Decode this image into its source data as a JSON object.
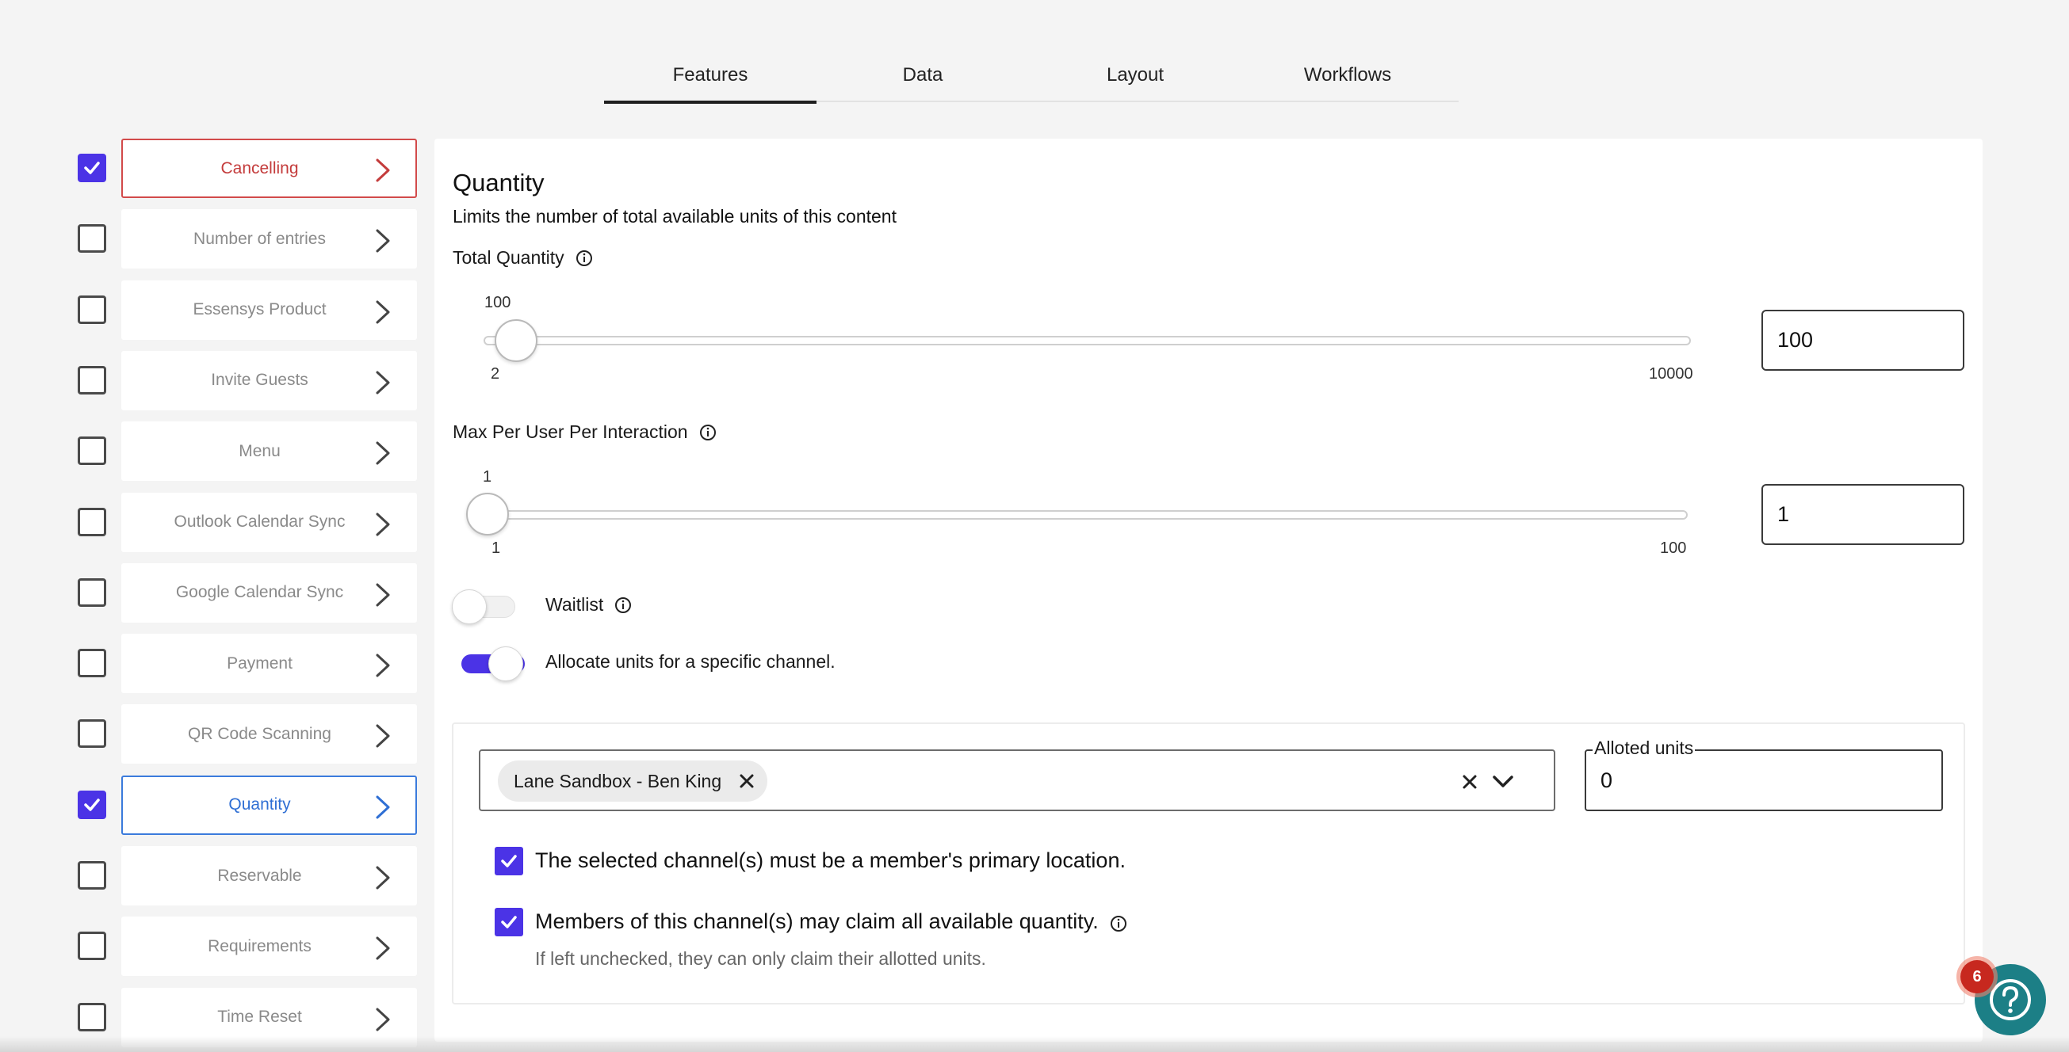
{
  "tabs": [
    {
      "label": "Features",
      "active": true
    },
    {
      "label": "Data",
      "active": false
    },
    {
      "label": "Layout",
      "active": false
    },
    {
      "label": "Workflows",
      "active": false
    }
  ],
  "sidebar": {
    "items": [
      {
        "label": "Cancelling",
        "checked": true,
        "state": "active-red"
      },
      {
        "label": "Number of entries",
        "checked": false
      },
      {
        "label": "Essensys Product",
        "checked": false
      },
      {
        "label": "Invite Guests",
        "checked": false
      },
      {
        "label": "Menu",
        "checked": false
      },
      {
        "label": "Outlook Calendar Sync",
        "checked": false
      },
      {
        "label": "Google Calendar Sync",
        "checked": false
      },
      {
        "label": "Payment",
        "checked": false
      },
      {
        "label": "QR Code Scanning",
        "checked": false
      },
      {
        "label": "Quantity",
        "checked": true,
        "state": "active-blue"
      },
      {
        "label": "Reservable",
        "checked": false
      },
      {
        "label": "Requirements",
        "checked": false
      },
      {
        "label": "Time Reset",
        "checked": false
      }
    ]
  },
  "quantity": {
    "title": "Quantity",
    "subtitle": "Limits the number of total available units of this content",
    "total": {
      "label": "Total Quantity",
      "current_label": "100",
      "min_label": "2",
      "max_label": "10000",
      "input_value": "100",
      "value": 100,
      "min": 2,
      "max": 10000
    },
    "max_per_user": {
      "label": "Max Per User Per Interaction",
      "current_label": "1",
      "min_label": "1",
      "max_label": "100",
      "input_value": "1",
      "value": 1,
      "min": 1,
      "max": 100
    },
    "waitlist": {
      "label": "Waitlist",
      "enabled": false
    },
    "allocate": {
      "label": "Allocate units for a specific channel.",
      "enabled": true
    },
    "channel": {
      "chip_label": "Lane Sandbox - Ben King",
      "alloted_legend": "Alloted units",
      "alloted_value": "0"
    },
    "primary_location": {
      "label": "The selected channel(s) must be a member's primary location.",
      "checked": true
    },
    "claim_all": {
      "label": "Members of this channel(s) may claim all available quantity.",
      "hint": "If left unchecked, they can only claim their allotted units.",
      "checked": true
    }
  },
  "help": {
    "badge_count": "6"
  },
  "colors": {
    "accent": "#4b33e6",
    "active_red": "#c43c3c",
    "active_blue": "#2f6fd4",
    "help_teal": "#1c7f86",
    "badge_red": "#c7281f"
  }
}
